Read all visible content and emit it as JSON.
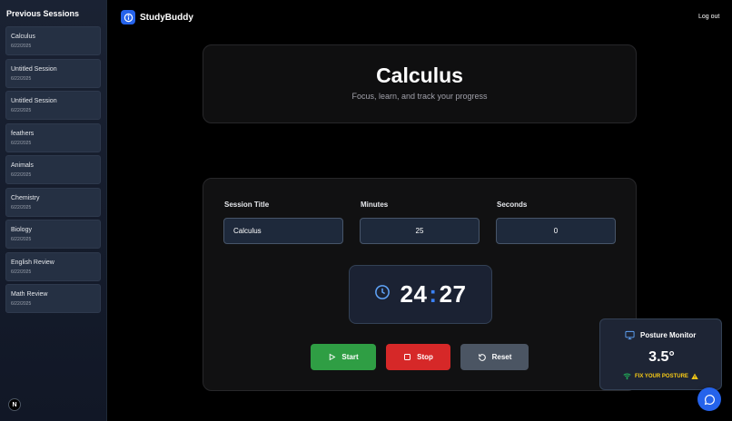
{
  "sidebar": {
    "title": "Previous Sessions",
    "sessions": [
      {
        "name": "Calculus",
        "date": "6/22/2025"
      },
      {
        "name": "Untitled Session",
        "date": "6/22/2025"
      },
      {
        "name": "Untitled Session",
        "date": "6/22/2025"
      },
      {
        "name": "feathers",
        "date": "6/22/2025"
      },
      {
        "name": "Animals",
        "date": "6/22/2025"
      },
      {
        "name": "Chemistry",
        "date": "6/22/2025"
      },
      {
        "name": "Biology",
        "date": "6/22/2025"
      },
      {
        "name": "English Review",
        "date": "6/22/2025"
      },
      {
        "name": "Math Review",
        "date": "6/22/2025"
      }
    ],
    "badge": "N"
  },
  "header": {
    "brand": "StudyBuddy",
    "logout_label": "Log out"
  },
  "hero": {
    "title": "Calculus",
    "subtitle": "Focus, learn, and track your progress"
  },
  "form": {
    "title_label": "Session Title",
    "title_value": "Calculus",
    "minutes_label": "Minutes",
    "minutes_value": "25",
    "seconds_label": "Seconds",
    "seconds_value": "0"
  },
  "timer": {
    "minutes": "24",
    "separator": ":",
    "seconds": "27"
  },
  "buttons": {
    "start": "Start",
    "stop": "Stop",
    "reset": "Reset"
  },
  "posture": {
    "title": "Posture Monitor",
    "value": "3.5°",
    "status": "FIX YOUR POSTURE"
  },
  "colors": {
    "accent": "#2563eb",
    "start": "#2f9e44",
    "stop": "#d62828",
    "reset": "#4b5563",
    "warning": "#facc15",
    "wifi": "#22c55e"
  },
  "icons": {
    "brand": "info-icon",
    "clock": "clock-icon",
    "start": "play-icon",
    "stop": "stop-icon",
    "reset": "reset-icon",
    "posture": "monitor-icon",
    "signal": "wifi-icon",
    "warning": "warning-icon",
    "chat": "chat-icon"
  }
}
